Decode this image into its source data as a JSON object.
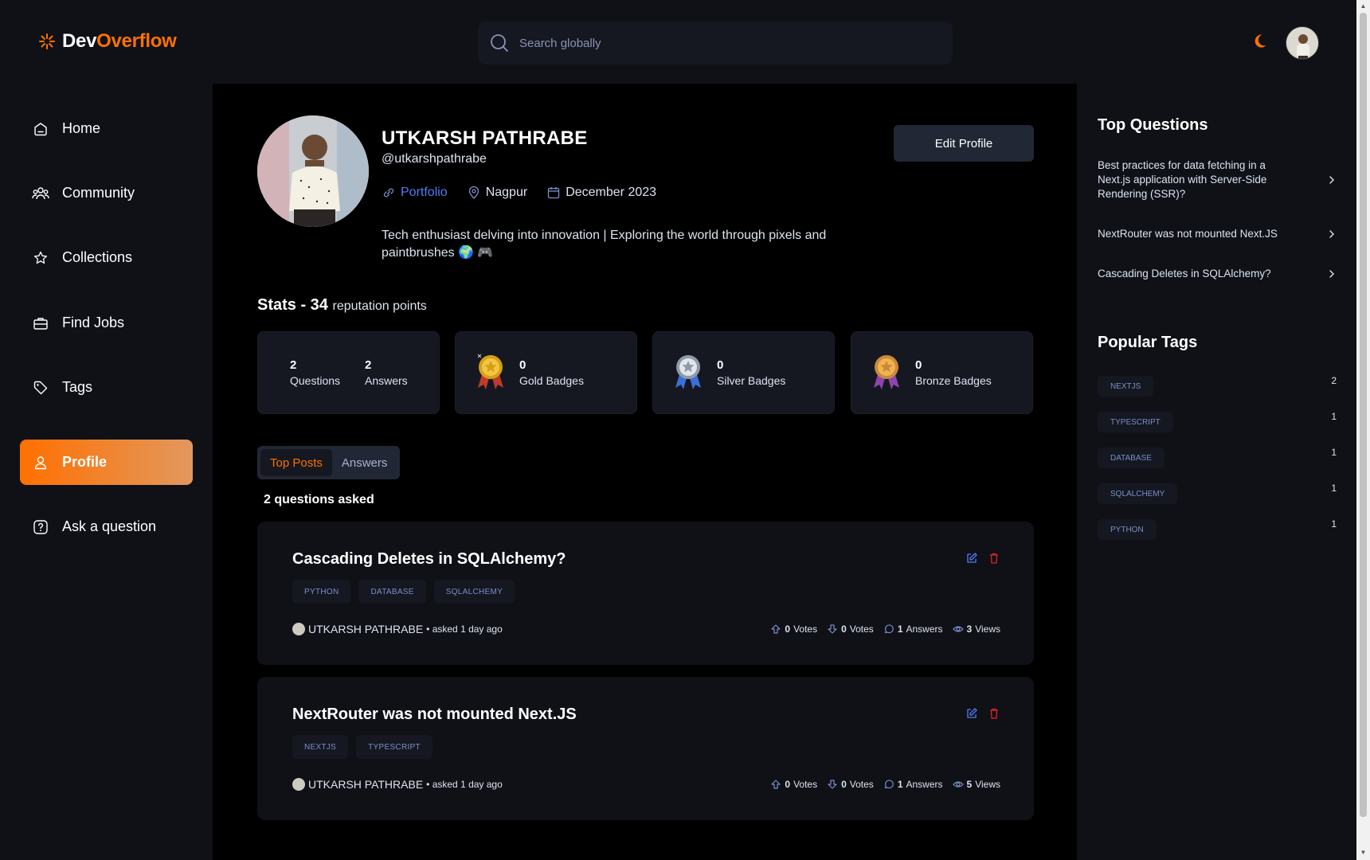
{
  "brand": {
    "part1": "Dev",
    "part2": "Overflow",
    "accent": "#ff7000"
  },
  "search": {
    "placeholder": "Search globally"
  },
  "sidebar": {
    "items": [
      {
        "label": "Home",
        "icon": "home-icon"
      },
      {
        "label": "Community",
        "icon": "community-icon"
      },
      {
        "label": "Collections",
        "icon": "star-icon"
      },
      {
        "label": "Find Jobs",
        "icon": "suitcase-icon"
      },
      {
        "label": "Tags",
        "icon": "tag-icon"
      },
      {
        "label": "Profile",
        "icon": "user-icon",
        "active": true
      },
      {
        "label": "Ask a question",
        "icon": "question-icon"
      }
    ]
  },
  "profile": {
    "name": "UTKARSH PATHRABE",
    "username": "@utkarshpathrabe",
    "portfolio": "Portfolio",
    "location": "Nagpur",
    "joined": "December 2023",
    "bio": "Tech enthusiast delving into innovation | Exploring the world through pixels and paintbrushes 🌍 🎮",
    "edit_label": "Edit Profile"
  },
  "stats": {
    "title": "Stats - 34",
    "points_label": "reputation points",
    "questions": {
      "value": "2",
      "label": "Questions"
    },
    "answers": {
      "value": "2",
      "label": "Answers"
    },
    "gold": {
      "value": "0",
      "label": "Gold Badges"
    },
    "silver": {
      "value": "0",
      "label": "Silver Badges"
    },
    "bronze": {
      "value": "0",
      "label": "Bronze Badges"
    }
  },
  "tabs": {
    "top_posts": "Top Posts",
    "answers": "Answers"
  },
  "questions_asked": "2 questions asked",
  "questions": [
    {
      "title": "Cascading Deletes in SQLAlchemy?",
      "tags": [
        "PYTHON",
        "DATABASE",
        "SQLALCHEMY"
      ],
      "author": "UTKARSH PATHRABE",
      "asked": "• asked 1 day ago",
      "upvotes": "0",
      "upvotes_label": "Votes",
      "downvotes": "0",
      "downvotes_label": "Votes",
      "answers": "1",
      "answers_label": "Answers",
      "views": "3",
      "views_label": "Views"
    },
    {
      "title": "NextRouter was not mounted Next.JS",
      "tags": [
        "NEXTJS",
        "TYPESCRIPT"
      ],
      "author": "UTKARSH PATHRABE",
      "asked": "• asked 1 day ago",
      "upvotes": "0",
      "upvotes_label": "Votes",
      "downvotes": "0",
      "downvotes_label": "Votes",
      "answers": "1",
      "answers_label": "Answers",
      "views": "5",
      "views_label": "Views"
    }
  ],
  "right_sidebar": {
    "top_questions_title": "Top Questions",
    "top_questions": [
      "Best practices for data fetching in a Next.js application with Server-Side Rendering (SSR)?",
      "NextRouter was not mounted Next.JS",
      "Cascading Deletes in SQLAlchemy?"
    ],
    "popular_tags_title": "Popular Tags",
    "popular_tags": [
      {
        "name": "NEXTJS",
        "count": "2"
      },
      {
        "name": "TYPESCRIPT",
        "count": "1"
      },
      {
        "name": "DATABASE",
        "count": "1"
      },
      {
        "name": "SQLALCHEMY",
        "count": "1"
      },
      {
        "name": "PYTHON",
        "count": "1"
      }
    ]
  }
}
